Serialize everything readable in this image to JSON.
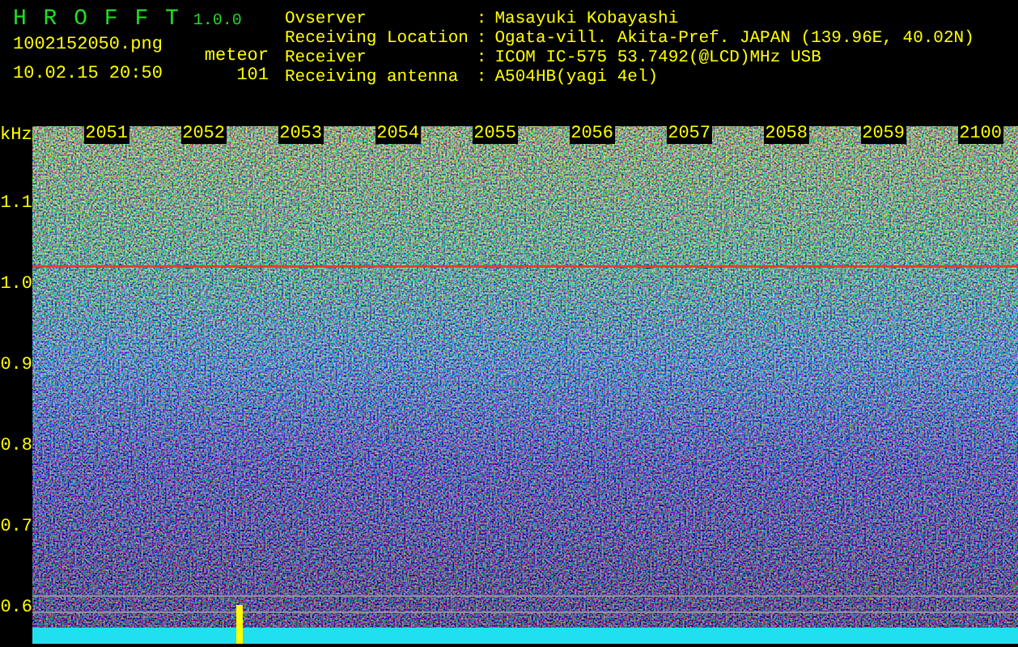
{
  "app": {
    "title": "H R O F F T",
    "version": "1.0.0"
  },
  "file_name": "1002152050.png",
  "timestamp": "10.02.15 20:50",
  "detection": {
    "label": "meteor",
    "count": "101"
  },
  "info": [
    {
      "label": "Ovserver",
      "separator": ":",
      "value": "Masayuki Kobayashi"
    },
    {
      "label": "Receiving Location",
      "separator": ":",
      "value": "Ogata-vill. Akita-Pref. JAPAN (139.96E, 40.02N)"
    },
    {
      "label": "Receiver",
      "separator": ":",
      "value": "ICOM IC-575 53.7492(@LCD)MHz USB"
    },
    {
      "label": "Receiving antenna",
      "separator": ":",
      "value": "A504HB(yagi 4el)"
    }
  ],
  "frequency_axis": {
    "unit": "kHz",
    "labels": [
      "1.1",
      "1.0",
      "0.9",
      "0.8",
      "0.7",
      "0.6"
    ]
  },
  "time_labels": [
    "2051",
    "2052",
    "2053",
    "2054",
    "2055",
    "2056",
    "2057",
    "2058",
    "2059",
    "2100"
  ]
}
